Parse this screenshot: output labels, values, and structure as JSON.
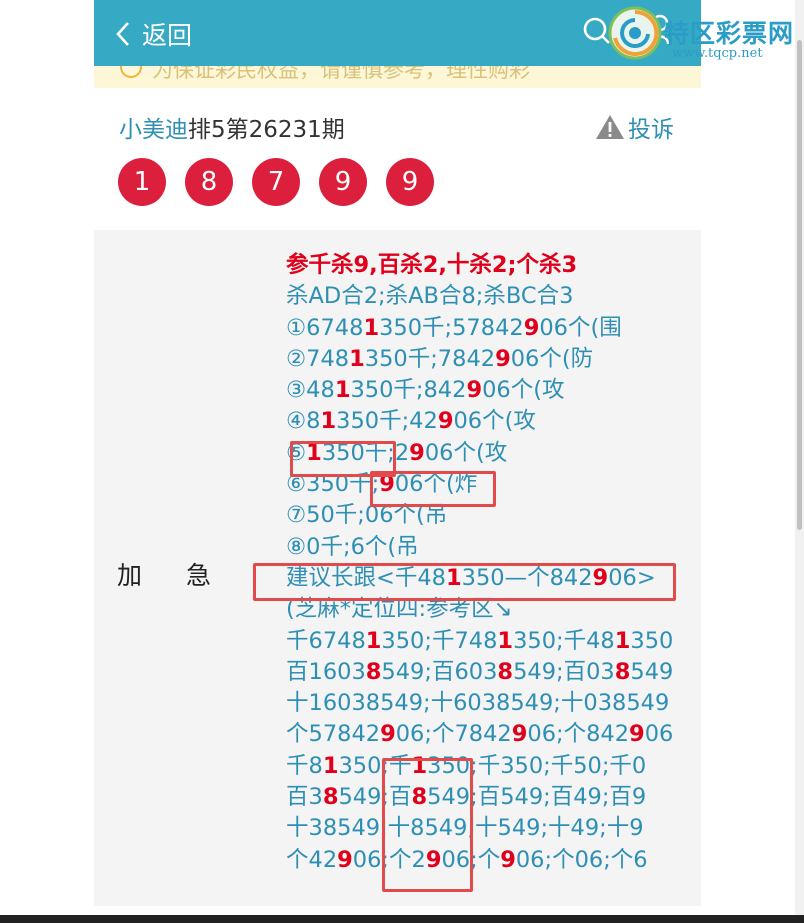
{
  "header": {
    "back_label": "返回"
  },
  "logo": {
    "title": "特区彩票网",
    "url": "www.tqcp.net"
  },
  "notice": {
    "text": "为保证彩民权益，请谨慎参考，理性购彩"
  },
  "post": {
    "author": "小美迪",
    "period": "排5第26231期",
    "report_label": "投诉",
    "balls": [
      "1",
      "8",
      "7",
      "9",
      "9"
    ]
  },
  "section": {
    "label": "加急",
    "lines": [
      [
        {
          "t": "参千杀9,百杀2,十杀2;个杀3",
          "r": false
        }
      ],
      [
        {
          "t": "杀AD合2;杀AB合8;杀BC合3",
          "r": false
        }
      ],
      [
        {
          "t": "①6748",
          "r": false
        },
        {
          "t": "1",
          "r": true
        },
        {
          "t": "350千;57842",
          "r": false
        },
        {
          "t": "9",
          "r": true
        },
        {
          "t": "06个(围",
          "r": false
        }
      ],
      [
        {
          "t": "②748",
          "r": false
        },
        {
          "t": "1",
          "r": true
        },
        {
          "t": "350千;7842",
          "r": false
        },
        {
          "t": "9",
          "r": true
        },
        {
          "t": "06个(防",
          "r": false
        }
      ],
      [
        {
          "t": "③48",
          "r": false
        },
        {
          "t": "1",
          "r": true
        },
        {
          "t": "350千;842",
          "r": false
        },
        {
          "t": "9",
          "r": true
        },
        {
          "t": "06个(攻",
          "r": false
        }
      ],
      [
        {
          "t": "④8",
          "r": false
        },
        {
          "t": "1",
          "r": true
        },
        {
          "t": "350千;42",
          "r": false
        },
        {
          "t": "9",
          "r": true
        },
        {
          "t": "06个(攻",
          "r": false
        }
      ],
      [
        {
          "t": "⑤",
          "r": false
        },
        {
          "t": "1",
          "r": true
        },
        {
          "t": "350千;2",
          "r": false
        },
        {
          "t": "9",
          "r": true
        },
        {
          "t": "06个(攻",
          "r": false
        }
      ],
      [
        {
          "t": "⑥350千;",
          "r": false
        },
        {
          "t": "9",
          "r": true
        },
        {
          "t": "06个(炸",
          "r": false
        }
      ],
      [
        {
          "t": "⑦50千;06个(吊",
          "r": false
        }
      ],
      [
        {
          "t": "⑧0千;6个(吊",
          "r": false
        }
      ],
      [
        {
          "t": "建议长跟<千48",
          "r": false
        },
        {
          "t": "1",
          "r": true
        },
        {
          "t": "350—个842",
          "r": false
        },
        {
          "t": "9",
          "r": true
        },
        {
          "t": "06>",
          "r": false
        }
      ],
      [
        {
          "t": "(芝麻*定位四:参考区↘",
          "r": false
        }
      ],
      [
        {
          "t": "千6748",
          "r": false
        },
        {
          "t": "1",
          "r": true
        },
        {
          "t": "350;千748",
          "r": false
        },
        {
          "t": "1",
          "r": true
        },
        {
          "t": "350;千48",
          "r": false
        },
        {
          "t": "1",
          "r": true
        },
        {
          "t": "350",
          "r": false
        }
      ],
      [
        {
          "t": "百1603",
          "r": false
        },
        {
          "t": "8",
          "r": true
        },
        {
          "t": "549;百603",
          "r": false
        },
        {
          "t": "8",
          "r": true
        },
        {
          "t": "549;百03",
          "r": false
        },
        {
          "t": "8",
          "r": true
        },
        {
          "t": "549",
          "r": false
        }
      ],
      [
        {
          "t": "十16038549;十6038549;十038549",
          "r": false
        }
      ],
      [
        {
          "t": "个57842",
          "r": false
        },
        {
          "t": "9",
          "r": true
        },
        {
          "t": "06;个7842",
          "r": false
        },
        {
          "t": "9",
          "r": true
        },
        {
          "t": "06;个842",
          "r": false
        },
        {
          "t": "9",
          "r": true
        },
        {
          "t": "06",
          "r": false
        }
      ],
      [
        {
          "t": "千8",
          "r": false
        },
        {
          "t": "1",
          "r": true
        },
        {
          "t": "350;千",
          "r": false
        },
        {
          "t": "1",
          "r": true
        },
        {
          "t": "350;千350;千50;千0",
          "r": false
        }
      ],
      [
        {
          "t": "百3",
          "r": false
        },
        {
          "t": "8",
          "r": true
        },
        {
          "t": "549;百",
          "r": false
        },
        {
          "t": "8",
          "r": true
        },
        {
          "t": "549;百549;百49;百9",
          "r": false
        }
      ],
      [
        {
          "t": "十38549;十8549;十549;十49;十9",
          "r": false
        }
      ],
      [
        {
          "t": "个42",
          "r": false
        },
        {
          "t": "9",
          "r": true
        },
        {
          "t": "06;个2",
          "r": false
        },
        {
          "t": "9",
          "r": true
        },
        {
          "t": "06;个",
          "r": false
        },
        {
          "t": "9",
          "r": true
        },
        {
          "t": "06;个06;个6",
          "r": false
        }
      ]
    ]
  },
  "colors": {
    "header_bg": "#36a9c4",
    "link": "#2e8fb5",
    "highlight_red": "#e0001b",
    "ball_red": "#dc1f3c",
    "box_red": "#e14b4b"
  }
}
